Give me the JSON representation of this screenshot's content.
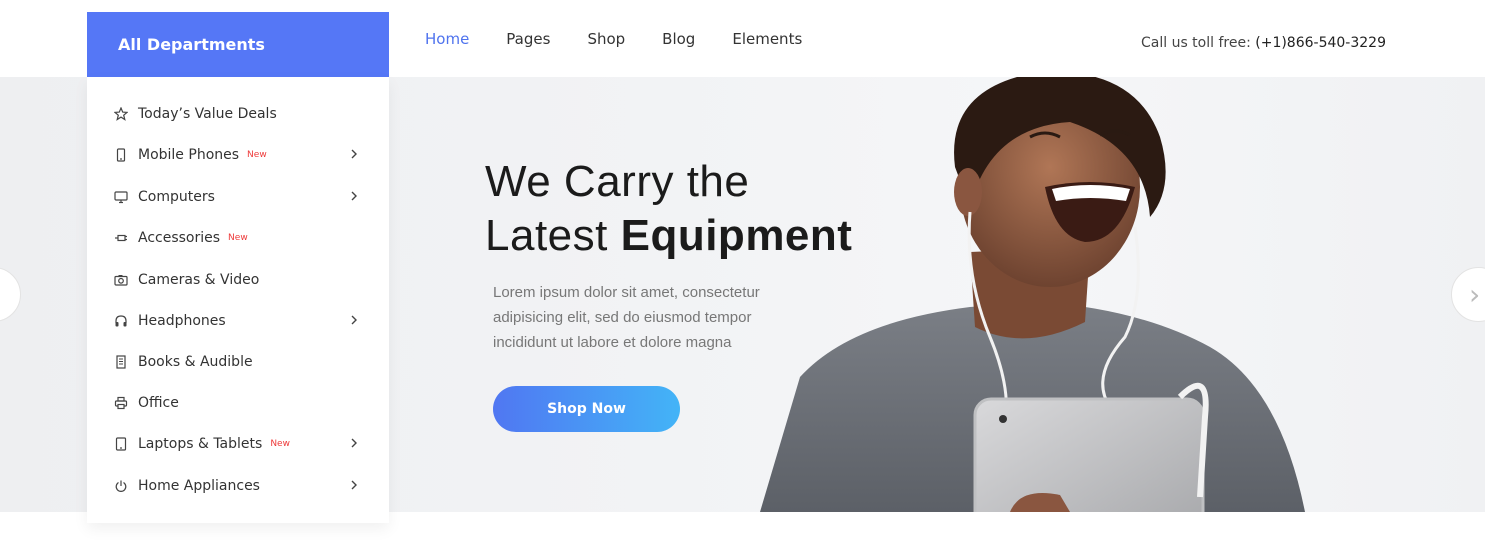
{
  "departments": {
    "title": "All Departments",
    "items": [
      {
        "label": "Today’s Value Deals",
        "icon": "star-icon",
        "badge": "",
        "has_submenu": false
      },
      {
        "label": "Mobile Phones",
        "icon": "phone-icon",
        "badge": "New",
        "has_submenu": true
      },
      {
        "label": "Computers",
        "icon": "monitor-icon",
        "badge": "",
        "has_submenu": true
      },
      {
        "label": "Accessories",
        "icon": "plug-icon",
        "badge": "New",
        "has_submenu": false
      },
      {
        "label": "Cameras & Video",
        "icon": "camera-icon",
        "badge": "",
        "has_submenu": false
      },
      {
        "label": "Headphones",
        "icon": "headphones-icon",
        "badge": "",
        "has_submenu": true
      },
      {
        "label": "Books & Audible",
        "icon": "book-icon",
        "badge": "",
        "has_submenu": false
      },
      {
        "label": "Office",
        "icon": "printer-icon",
        "badge": "",
        "has_submenu": false
      },
      {
        "label": "Laptops & Tablets",
        "icon": "tablet-icon",
        "badge": "New",
        "has_submenu": true
      },
      {
        "label": "Home Appliances",
        "icon": "power-icon",
        "badge": "",
        "has_submenu": true
      }
    ]
  },
  "nav": {
    "items": [
      "Home",
      "Pages",
      "Shop",
      "Blog",
      "Elements"
    ],
    "active": "Home"
  },
  "contact": {
    "label": "Call us toll free:",
    "phone": "(+1)866-540-3229"
  },
  "hero": {
    "line1": "We Carry the",
    "line2_light": "Latest",
    "line2_bold": "Equipment",
    "description": "Lorem ipsum dolor sit amet, consectetur adipisicing elit, sed do eiusmod tempor incididunt ut labore et dolore magna",
    "button_label": "Shop Now"
  },
  "colors": {
    "accent": "#5577f6",
    "badge": "#ee3b3b",
    "button_gradient_start": "#5077f2",
    "button_gradient_end": "#43b4f7"
  }
}
